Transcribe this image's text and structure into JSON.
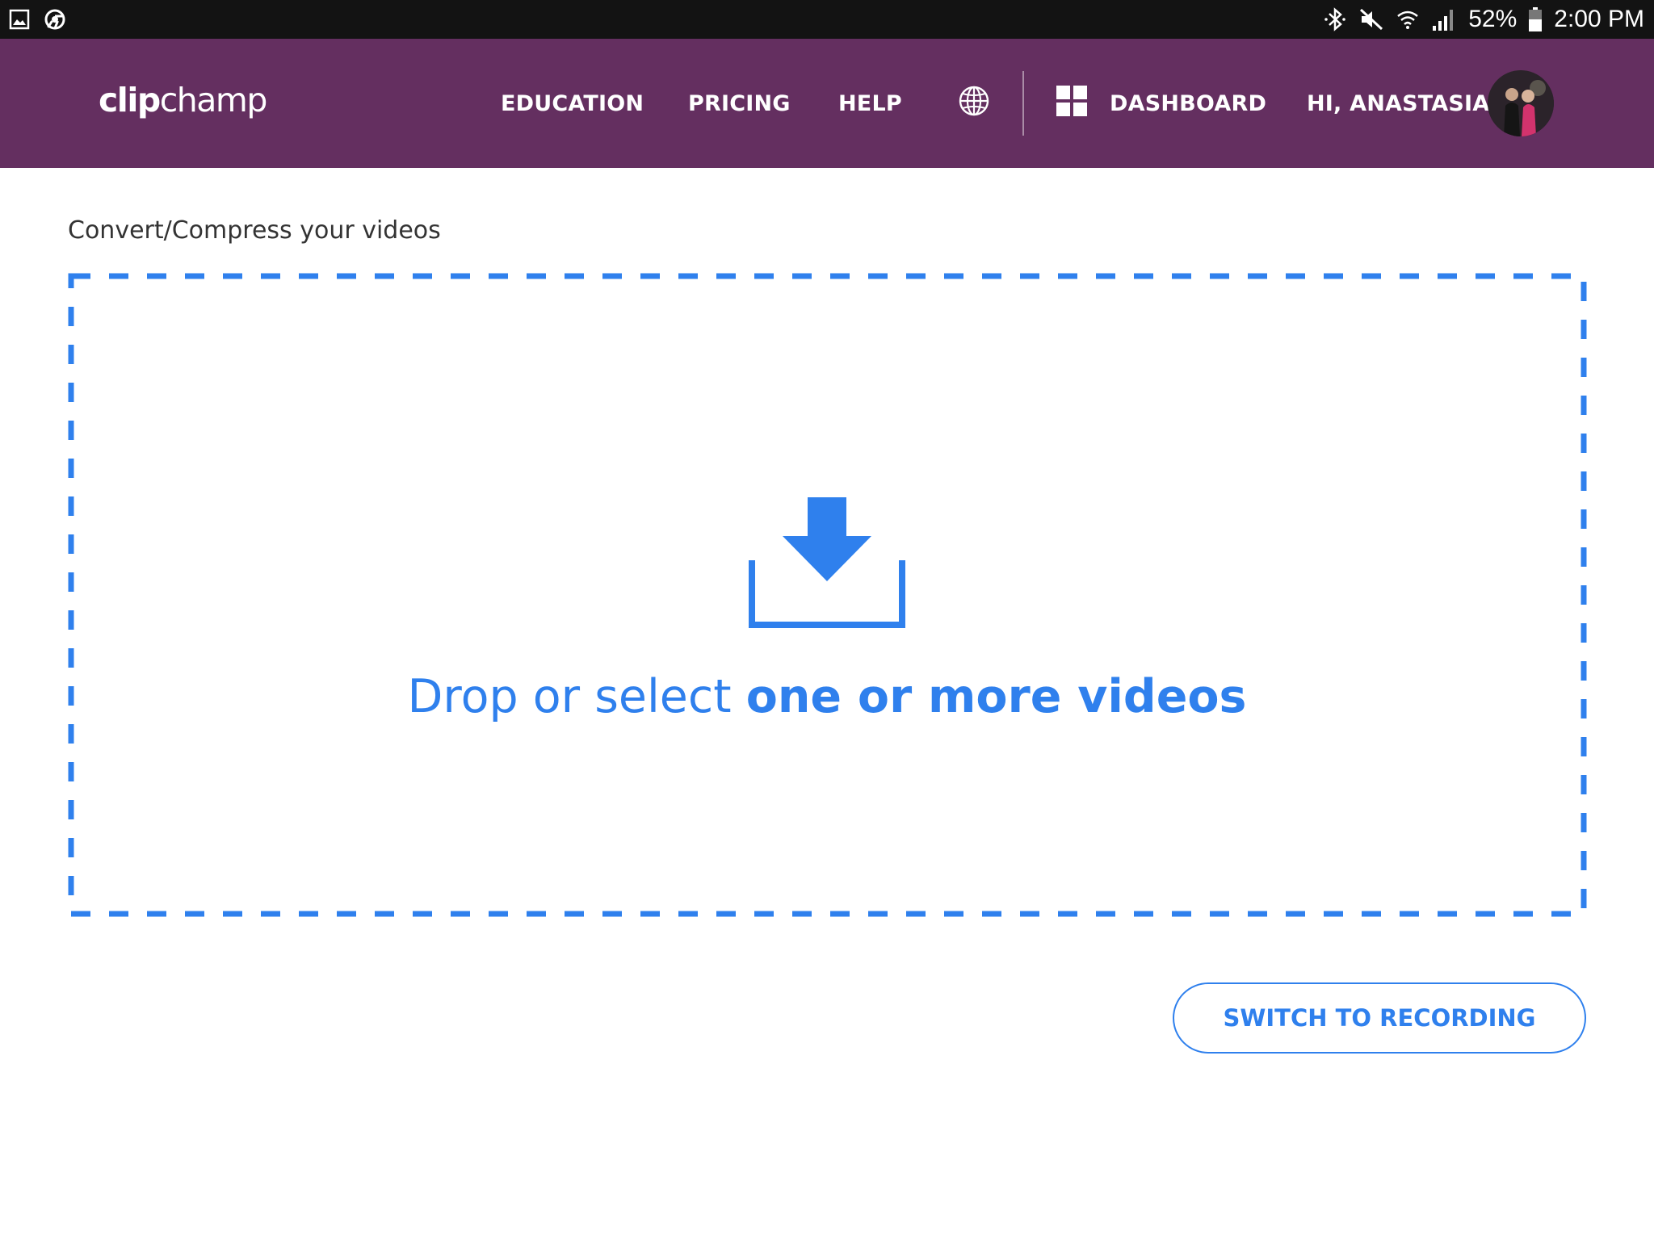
{
  "status_bar": {
    "left_icons": [
      "image-notification-icon",
      "chrome-icon"
    ],
    "right_icons": [
      "bluetooth-icon",
      "mute-icon",
      "wifi-icon",
      "signal-icon",
      "battery-icon"
    ],
    "battery": "52%",
    "time": "2:00 PM"
  },
  "header": {
    "logo_bold": "clip",
    "logo_light": "champ",
    "nav": {
      "education": "EDUCATION",
      "pricing": "PRICING",
      "help": "HELP",
      "dashboard": "DASHBOARD",
      "user_greeting": "HI, ANASTASIA!"
    },
    "icons": [
      "globe-icon",
      "grid-icon"
    ]
  },
  "main": {
    "section_title": "Convert/Compress your videos",
    "dropzone": {
      "icon": "download-icon",
      "text_prefix": "Drop or select ",
      "text_emphasis": "one or more videos"
    },
    "switch_button": "SWITCH TO RECORDING"
  },
  "colors": {
    "status_bar_bg": "#131313",
    "navbar_bg": "#642f60",
    "accent_blue": "#2f80ed",
    "text_dark": "#333333"
  }
}
